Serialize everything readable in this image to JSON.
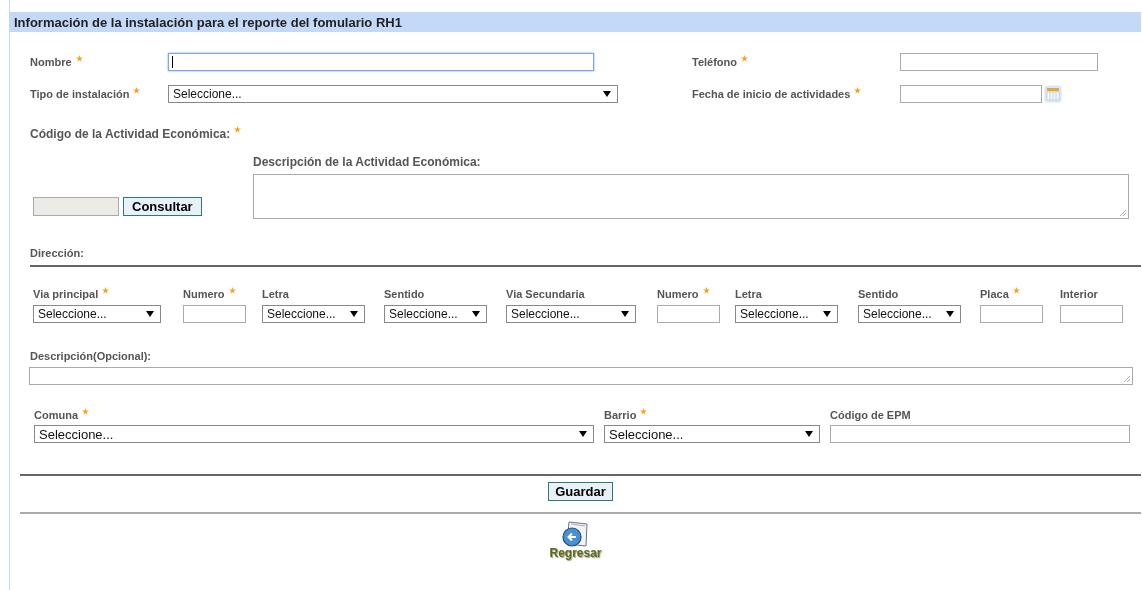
{
  "header": {
    "title": "Información de la instalación para el reporte del fomulario RH1"
  },
  "top_fields": [
    {
      "kind": "text",
      "label": "Nombre",
      "required": true,
      "focused": true
    },
    {
      "kind": "text",
      "label": "Teléfono",
      "required": true,
      "focused": false
    },
    {
      "kind": "select",
      "label": "Tipo de instalación",
      "required": true,
      "value": "Seleccione..."
    },
    {
      "kind": "date",
      "label": "Fecha de inicio de actividades",
      "required": true,
      "focused": false
    }
  ],
  "activity": {
    "code_label": "Código de la Actividad Económica:",
    "required": true,
    "button": "Consultar",
    "description_label": "Descripción de la Actividad Económica:"
  },
  "address": {
    "title": "Dirección:",
    "fields": [
      {
        "kind": "select",
        "label": "Via principal",
        "required": true,
        "value": "Seleccione..."
      },
      {
        "kind": "text",
        "label": "Numero",
        "required": true
      },
      {
        "kind": "select",
        "label": "Letra",
        "required": false,
        "value": "Seleccione..."
      },
      {
        "kind": "select",
        "label": "Sentido",
        "required": false,
        "value": "Seleccione..."
      },
      {
        "kind": "select",
        "label": "Via Secundaria",
        "required": false,
        "value": "Seleccione..."
      },
      {
        "kind": "text",
        "label": "Numero",
        "required": true
      },
      {
        "kind": "select",
        "label": "Letra",
        "required": false,
        "value": "Seleccione..."
      },
      {
        "kind": "select",
        "label": "Sentido",
        "required": false,
        "value": "Seleccione..."
      },
      {
        "kind": "text",
        "label": "Placa",
        "required": true
      },
      {
        "kind": "text",
        "label": "Interior",
        "required": false
      }
    ],
    "description_label": "Descripción(Opcional):"
  },
  "location_fields": [
    {
      "kind": "select",
      "label": "Comuna",
      "required": true,
      "value": "Seleccione..."
    },
    {
      "kind": "select",
      "label": "Barrio",
      "required": true,
      "value": "Seleccione..."
    },
    {
      "kind": "text",
      "label": "Código de EPM",
      "required": false
    }
  ],
  "save_button": "Guardar",
  "back_link": "Regresar"
}
